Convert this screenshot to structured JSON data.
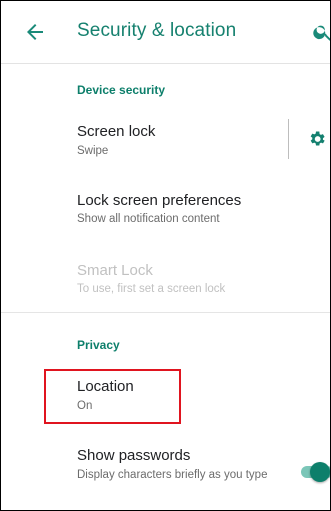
{
  "header": {
    "title": "Security & location",
    "back_icon": "arrow-left-icon",
    "search_icon": "search-icon"
  },
  "sections": {
    "device_security": "Device security",
    "privacy": "Privacy"
  },
  "items": {
    "screen_lock": {
      "title": "Screen lock",
      "subtitle": "Swipe",
      "settings_icon": "gear-icon"
    },
    "lock_screen_prefs": {
      "title": "Lock screen preferences",
      "subtitle": "Show all notification content"
    },
    "smart_lock": {
      "title": "Smart Lock",
      "subtitle": "To use, first set a screen lock",
      "enabled": false
    },
    "location": {
      "title": "Location",
      "subtitle": "On"
    },
    "show_passwords": {
      "title": "Show passwords",
      "subtitle": "Display characters briefly as you type",
      "toggle_on": true
    }
  },
  "colors": {
    "accent": "#16816f",
    "highlight_box": "#e0141f"
  }
}
